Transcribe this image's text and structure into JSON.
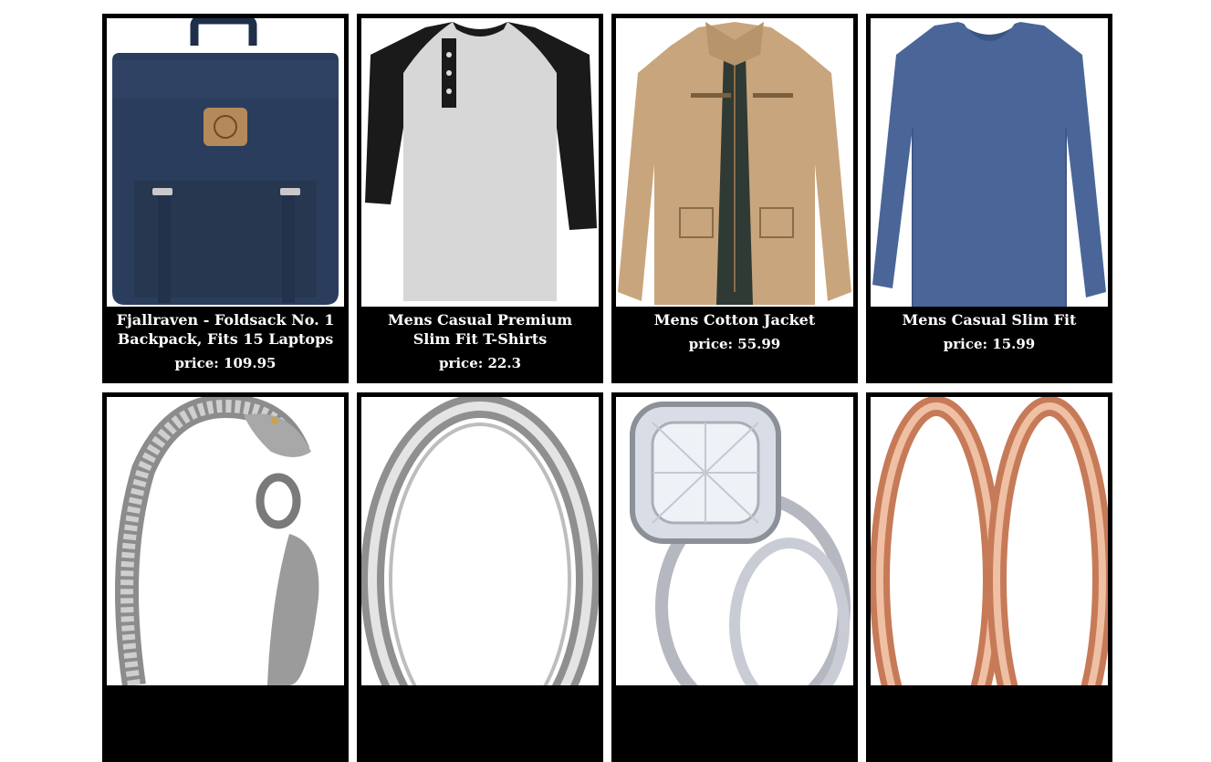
{
  "products": [
    {
      "title": "Fjallraven - Foldsack No. 1 Backpack, Fits 15 Laptops",
      "price": "price: 109.95",
      "icon": "backpack-icon"
    },
    {
      "title": "Mens Casual Premium Slim Fit T-Shirts",
      "price": "price: 22.3",
      "icon": "tshirt-icon"
    },
    {
      "title": "Mens Cotton Jacket",
      "price": "price: 55.99",
      "icon": "jacket-icon"
    },
    {
      "title": "Mens Casual Slim Fit",
      "price": "price: 15.99",
      "icon": "longsleeve-shirt-icon"
    },
    {
      "title": "",
      "price": "",
      "icon": "bracelet-icon"
    },
    {
      "title": "",
      "price": "",
      "icon": "silver-ring-icon"
    },
    {
      "title": "",
      "price": "",
      "icon": "diamond-ring-icon"
    },
    {
      "title": "",
      "price": "",
      "icon": "rose-gold-rings-icon"
    }
  ]
}
